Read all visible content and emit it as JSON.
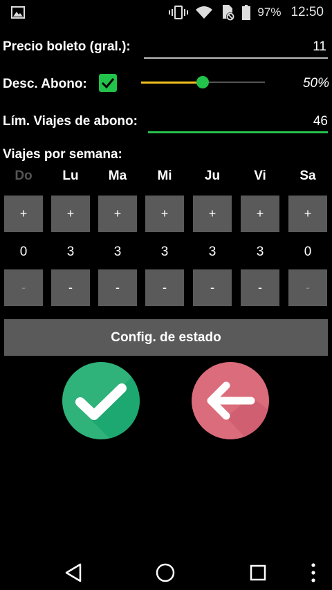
{
  "status_bar": {
    "battery_percent": "97%",
    "time": "12:50",
    "icons": [
      "image-icon",
      "vibrate-icon",
      "wifi-icon",
      "sim-blocked-icon",
      "battery-icon"
    ]
  },
  "form": {
    "precio_label": "Precio boleto (gral.):",
    "precio_value": "11",
    "descuento_label": "Desc. Abono:",
    "descuento_checked": true,
    "descuento_percent": "50%",
    "descuento_fraction": 0.5,
    "limite_label": "Lím. Viajes de abono:",
    "limite_value": "46",
    "viajes_label": "Viajes por semana:"
  },
  "days": [
    {
      "name": "Do",
      "count": "0",
      "plus": "+",
      "minus": "-",
      "enabled": false
    },
    {
      "name": "Lu",
      "count": "3",
      "plus": "+",
      "minus": "-",
      "enabled": true
    },
    {
      "name": "Ma",
      "count": "3",
      "plus": "+",
      "minus": "-",
      "enabled": true
    },
    {
      "name": "Mi",
      "count": "3",
      "plus": "+",
      "minus": "-",
      "enabled": true
    },
    {
      "name": "Ju",
      "count": "3",
      "plus": "+",
      "minus": "-",
      "enabled": true
    },
    {
      "name": "Vi",
      "count": "3",
      "plus": "+",
      "minus": "-",
      "enabled": true
    },
    {
      "name": "Sa",
      "count": "0",
      "plus": "+",
      "minus": "-",
      "enabled": true
    }
  ],
  "config_button": "Config. de estado",
  "actions": {
    "confirm_color": "#2fb37a",
    "back_color": "#db6c7b"
  },
  "colors": {
    "accent_green": "#22c34a",
    "slider_yellow": "#f2c21b",
    "button_gray": "#5a5a5a"
  }
}
